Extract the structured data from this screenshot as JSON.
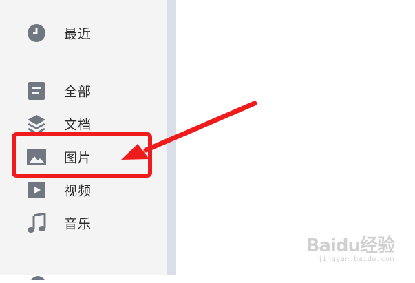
{
  "sidebar": {
    "items": [
      {
        "label": "最近",
        "icon": "clock-icon"
      },
      {
        "label": "全部",
        "icon": "document-icon"
      },
      {
        "label": "文档",
        "icon": "layers-icon"
      },
      {
        "label": "图片",
        "icon": "image-icon"
      },
      {
        "label": "视频",
        "icon": "play-icon"
      },
      {
        "label": "音乐",
        "icon": "music-note-icon"
      }
    ]
  },
  "annotation": {
    "highlight_color": "#ee1c1c"
  },
  "watermark": {
    "brand": "Baidu经验",
    "url": "jingyan.baidu.com"
  }
}
